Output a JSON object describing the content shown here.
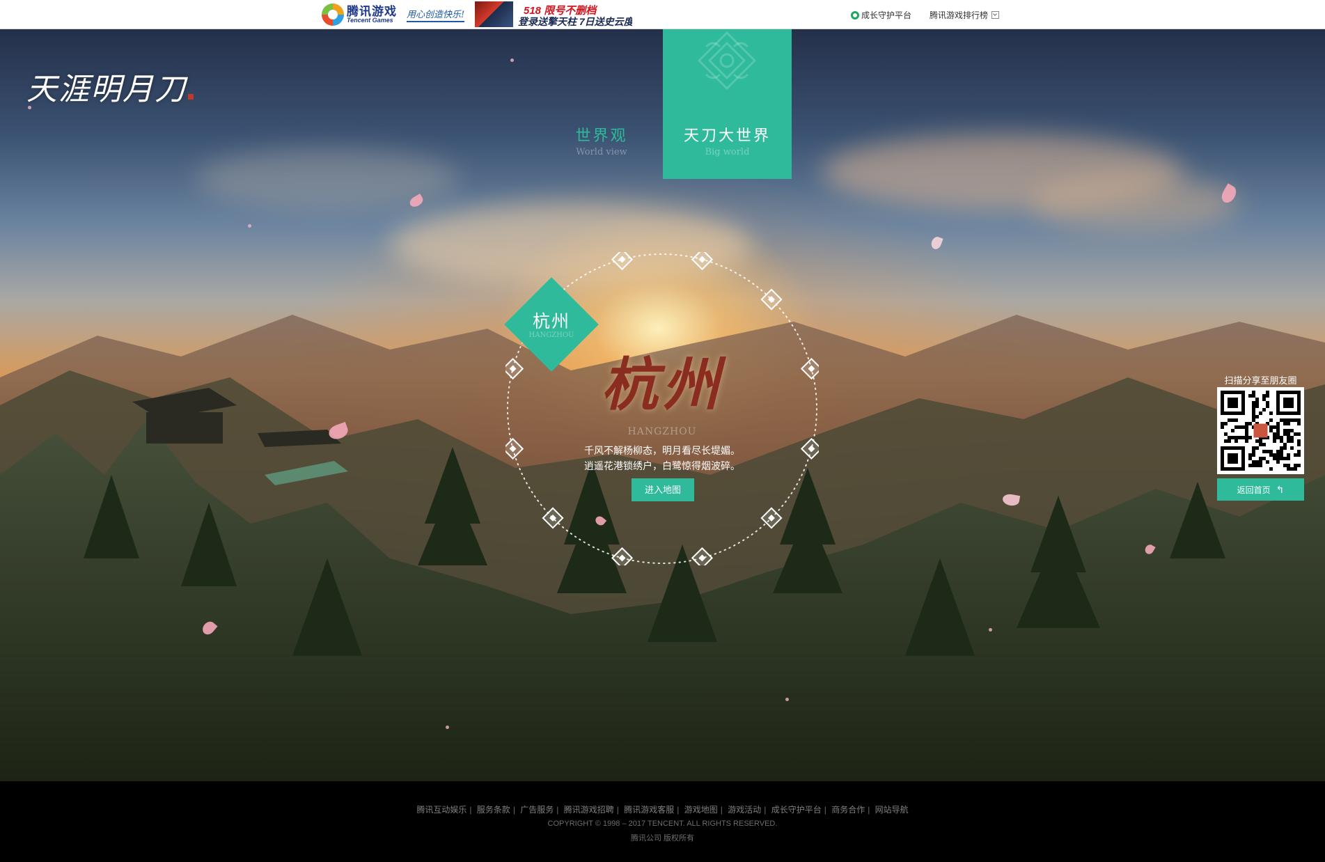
{
  "topbar": {
    "brand_cn": "腾讯游戏",
    "brand_en": "Tencent Games",
    "slogan": "用心创造快乐!",
    "ad_line1": "518 限号不删档",
    "ad_line2": "登录送擎天柱 7日送史云度",
    "growth_guard": "成长守护平台",
    "rank_list": "腾讯游戏排行榜"
  },
  "logo": {
    "text": "天涯明月刀"
  },
  "tabs": [
    {
      "cn": "世界观",
      "en": "World view",
      "active": false
    },
    {
      "cn": "天刀大世界",
      "en": "Big world",
      "active": true
    }
  ],
  "city": {
    "badge_cn": "杭州",
    "badge_en": "HANGZHOU",
    "title": "杭州",
    "pinyin": "HANGZHOU",
    "desc_line1": "千风不解杨柳态，明月看尽长堤媚。",
    "desc_line2": "逍遥花港锁绣户，白鹭惊得烟波碎。",
    "enter_button": "进入地图"
  },
  "share": {
    "title": "扫描分享至朋友圈",
    "back_button": "返回首页"
  },
  "footer": {
    "links": [
      "腾讯互动娱乐",
      "服务条款",
      "广告服务",
      "腾讯游戏招聘",
      "腾讯游戏客服",
      "游戏地图",
      "游戏活动",
      "成长守护平台",
      "商务合作",
      "网站导航"
    ],
    "copyright": "COPYRIGHT © 1998 – 2017 TENCENT. ALL RIGHTS RESERVED.",
    "company": "腾讯公司 版权所有"
  },
  "colors": {
    "accent": "#2fbb9b",
    "title_red": "#8a2c1f"
  }
}
